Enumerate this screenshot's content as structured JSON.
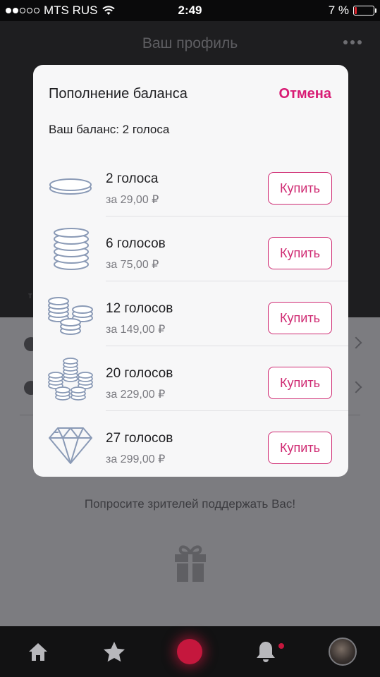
{
  "status_bar": {
    "carrier": "MTS RUS",
    "time": "2:49",
    "battery_text": "7 %",
    "signal_bars_filled": 2,
    "signal_bars_total": 5,
    "battery_level": 0.07
  },
  "navbar": {
    "title": "Ваш профиль"
  },
  "background": {
    "support_text": "Попросите зрителей поддержать Вас!",
    "side_letter": "т"
  },
  "modal": {
    "title": "Пополнение баланса",
    "cancel_label": "Отмена",
    "balance_text": "Ваш баланс: 2 голоса",
    "packages": [
      {
        "name": "2 голоса",
        "price": "за 29,00 ₽",
        "button": "Купить",
        "icon": "single-coin-icon"
      },
      {
        "name": "6 голосов",
        "price": "за 75,00 ₽",
        "button": "Купить",
        "icon": "coin-stack-icon"
      },
      {
        "name": "12 голосов",
        "price": "за 149,00 ₽",
        "button": "Купить",
        "icon": "coin-stacks-icon"
      },
      {
        "name": "20 голосов",
        "price": "за 229,00 ₽",
        "button": "Купить",
        "icon": "coin-pile-icon"
      },
      {
        "name": "27 голосов",
        "price": "за 299,00 ₽",
        "button": "Купить",
        "icon": "diamond-icon"
      }
    ]
  },
  "tabbar": {
    "items": [
      "home-icon",
      "star-icon",
      "record-button",
      "bell-icon",
      "avatar"
    ]
  },
  "colors": {
    "accent": "#d81b74",
    "record": "#c5173d",
    "coin_stroke": "#8a9ab6"
  }
}
